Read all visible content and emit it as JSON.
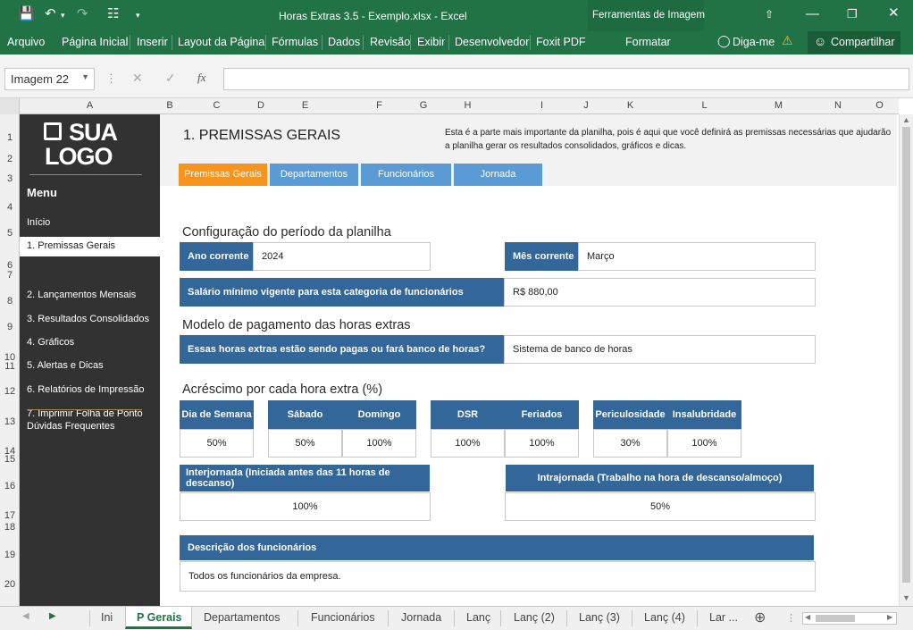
{
  "titlebar": {
    "title": "Horas Extras 3.5 - Exemplo.xlsx - Excel",
    "tools_label": "Ferramentas de Imagem"
  },
  "ribbon": {
    "file": "Arquivo",
    "tabs": [
      "Página Inicial",
      "Inserir",
      "Layout da Página",
      "Fórmulas",
      "Dados",
      "Revisão",
      "Exibir",
      "Desenvolvedor",
      "Foxit PDF"
    ],
    "format": "Formatar",
    "tell_me": "Diga-me",
    "share": "Compartilhar"
  },
  "formula": {
    "name_box": "Imagem 22",
    "fx": "fx",
    "value": ""
  },
  "columns": [
    "A",
    "B",
    "C",
    "D",
    "E",
    "F",
    "G",
    "H",
    "I",
    "J",
    "K",
    "L",
    "M",
    "N",
    "O"
  ],
  "rows": [
    "1",
    "2",
    "3",
    "4",
    "5",
    "6",
    "7",
    "8",
    "9",
    "10",
    "11",
    "12",
    "13",
    "14",
    "15",
    "16",
    "17",
    "18",
    "19",
    "20"
  ],
  "logo": {
    "line1": "SUA",
    "line2": "LOGO"
  },
  "sidebar": {
    "menu_title": "Menu",
    "items": [
      "Início",
      "1. Premissas Gerais",
      "2. Lançamentos Mensais",
      "3. Resultados Consolidados",
      "4. Gráficos",
      "5. Alertas e Dicas",
      "6. Relatórios de Impressão",
      "7. Imprimir Folha de Ponto"
    ],
    "faq": "Dúvidas Frequentes"
  },
  "page": {
    "title": "1. PREMISSAS GERAIS",
    "description": "Esta é a parte mais importante da planilha, pois é aqui que você definirá as premissas necessárias que ajudarão a planilha gerar os resultados consolidados, gráficos e dicas."
  },
  "tabs": [
    "Premissas Gerais",
    "Departamentos",
    "Funcionários",
    "Jornada"
  ],
  "colors": {
    "accent": "#f7941d",
    "header_blue": "#336699",
    "tab_blue": "#5b9bd5",
    "excel_green": "#217346",
    "sidebar": "#323232"
  },
  "period": {
    "title": "Configuração do período da planilha",
    "year_label": "Ano corrente",
    "year_value": "2024",
    "month_label": "Mês corrente",
    "month_value": "Março",
    "salary_label": "Salário mínimo vigente para esta categoria de funcionários",
    "salary_value": "R$ 880,00"
  },
  "payment": {
    "title": "Modelo de pagamento das horas extras",
    "question": "Essas horas extras estão sendo pagas ou fará banco de horas?",
    "answer": "Sistema de banco de horas"
  },
  "rates": {
    "title": "Acréscimo por cada hora extra (%)",
    "items": [
      {
        "label": "Dia de Semana",
        "value": "50%"
      },
      {
        "label": "Sábado",
        "value": "50%"
      },
      {
        "label": "Domingo",
        "value": "100%"
      },
      {
        "label": "DSR",
        "value": "100%"
      },
      {
        "label": "Feriados",
        "value": "100%"
      },
      {
        "label": "Periculosidade",
        "value": "30%"
      },
      {
        "label": "Insalubridade",
        "value": "100%"
      }
    ],
    "inter_label": "Interjornada (Iniciada antes das 11 horas de descanso)",
    "inter_value": "100%",
    "intra_label": "Intrajornada (Trabalho na hora de descanso/almoço)",
    "intra_value": "50%"
  },
  "employees": {
    "label": "Descrição dos funcionários",
    "value": "Todos os funcionários da empresa."
  },
  "sheet_tabs": [
    "Ini",
    "P Gerais",
    "Departamentos",
    "Funcionários",
    "Jornada",
    "Lanç",
    "Lanç (2)",
    "Lanç (3)",
    "Lanç (4)",
    "Lar ..."
  ]
}
